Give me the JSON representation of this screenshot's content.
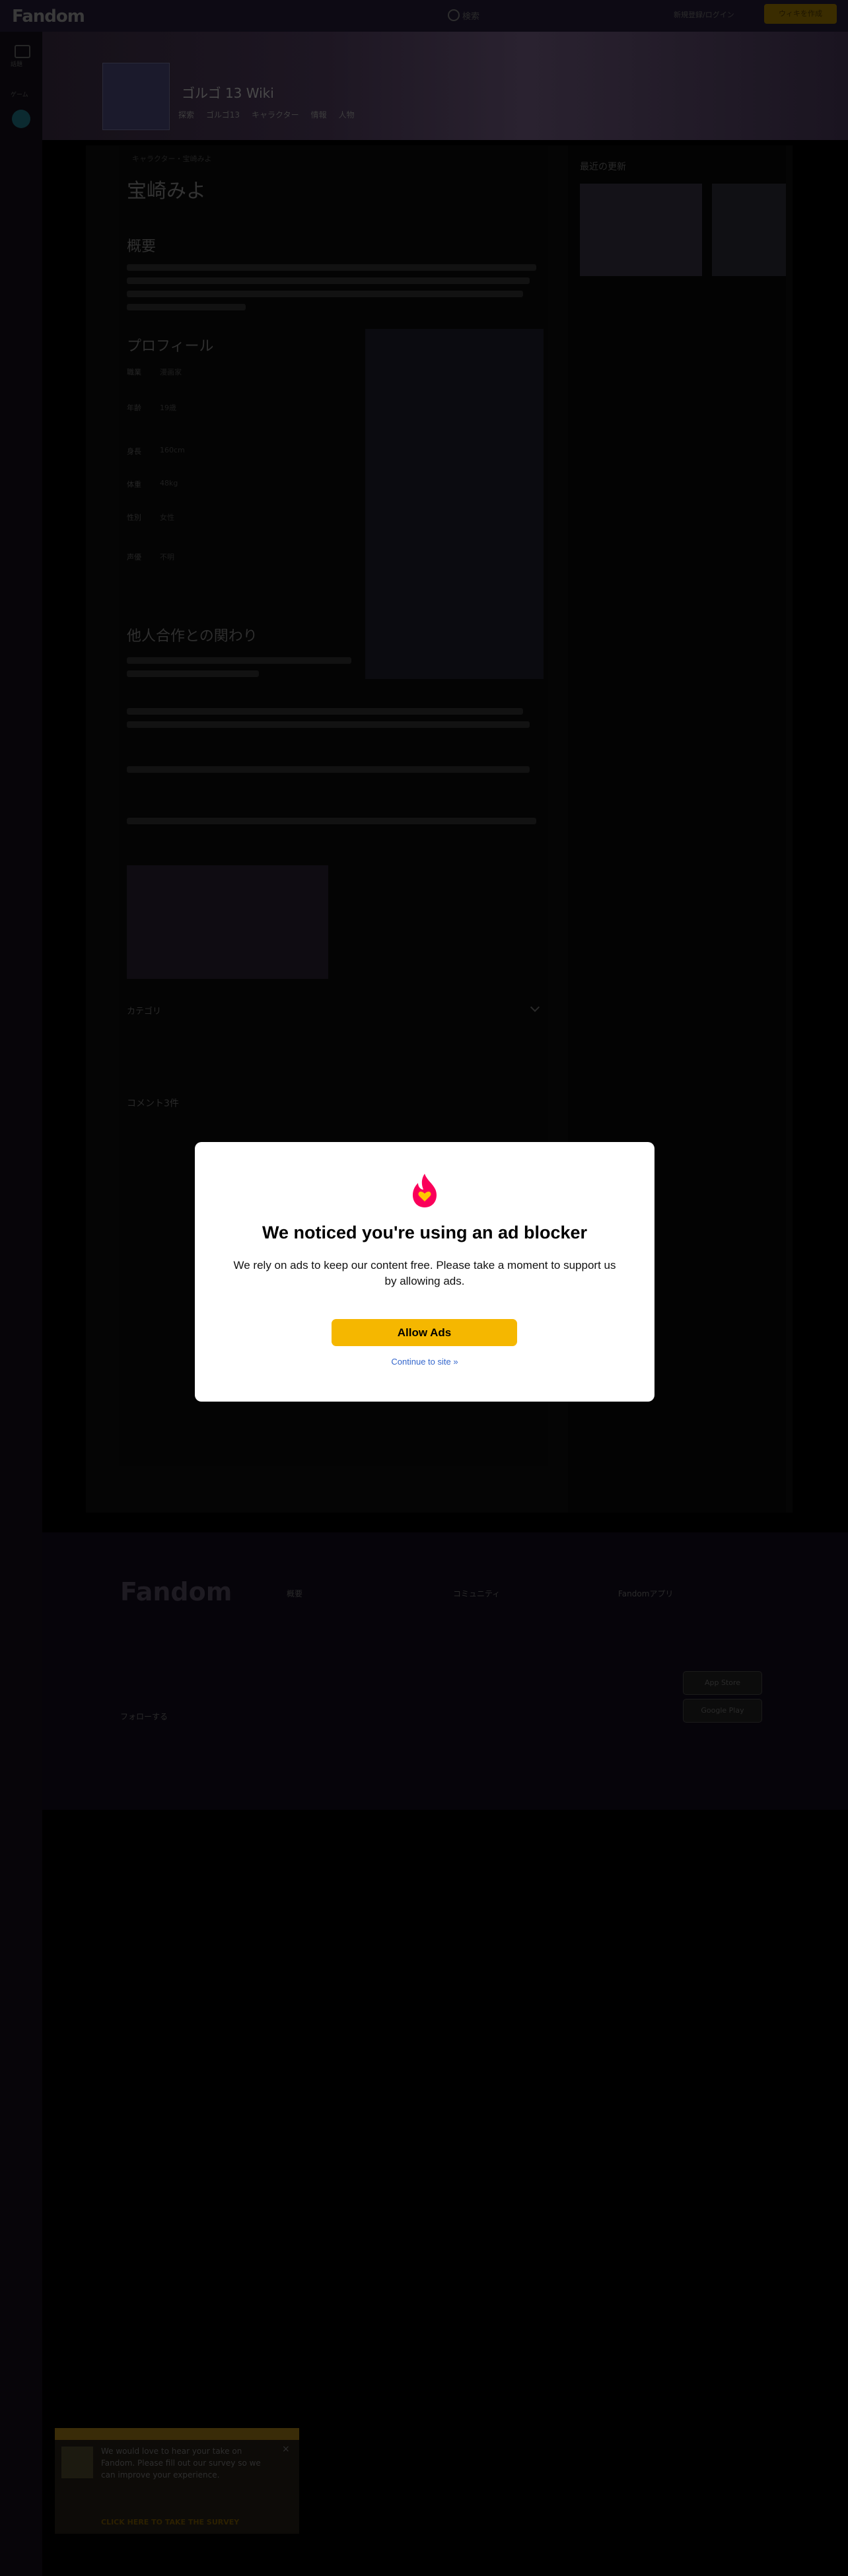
{
  "global_nav": {
    "logo": "Fandom",
    "search_placeholder": "検索",
    "signin_label": "新規登録/ログイン",
    "start_wiki_label": "ウィキを作成"
  },
  "left_rail": {
    "item1": "話題",
    "item2": "ゲーム"
  },
  "wiki": {
    "title": "ゴルゴ 13 Wiki",
    "tabs": [
      "探索",
      "ゴルゴ13",
      "キャラクター",
      "情報",
      "人物"
    ]
  },
  "article": {
    "breadcrumb": "キャラクター・宝崎みよ",
    "title": "宝崎みよ",
    "sections": [
      {
        "heading": "概要"
      },
      {
        "heading": "プロフィール"
      },
      {
        "heading": "他人合作との関わり"
      }
    ],
    "profile_rows": [
      {
        "label": "職業",
        "value": "漫画家"
      },
      {
        "label": "年齢",
        "value": "19歳"
      },
      {
        "label": "身長",
        "value": "160cm"
      },
      {
        "label": "体重",
        "value": "48kg"
      },
      {
        "label": "性別",
        "value": "女性"
      },
      {
        "label": "声優",
        "value": "不明"
      }
    ],
    "categories_label": "カテゴリ",
    "comments_label": "コメント3件"
  },
  "right_rail": {
    "title": "最近の更新"
  },
  "modal": {
    "title": "We noticed you're using an ad blocker",
    "body": "We rely on ads to keep our content free. Please take a moment to support us by allowing ads.",
    "allow_label": "Allow Ads",
    "continue_label": "Continue to site »",
    "brand_color": "#fa005a",
    "button_color": "#f5b700"
  },
  "footer": {
    "logo": "Fandom",
    "follow_label": "フォローする",
    "col1_title": "概要",
    "col2_title": "コミュニティ",
    "col3_title": "Fandomアプリ",
    "app_store": "App Store",
    "google_play": "Google Play"
  },
  "survey": {
    "text": "We would love to hear your take on Fandom. Please fill out our survey so we can improve your experience.",
    "link": "CLICK HERE TO TAKE THE SURVEY"
  }
}
